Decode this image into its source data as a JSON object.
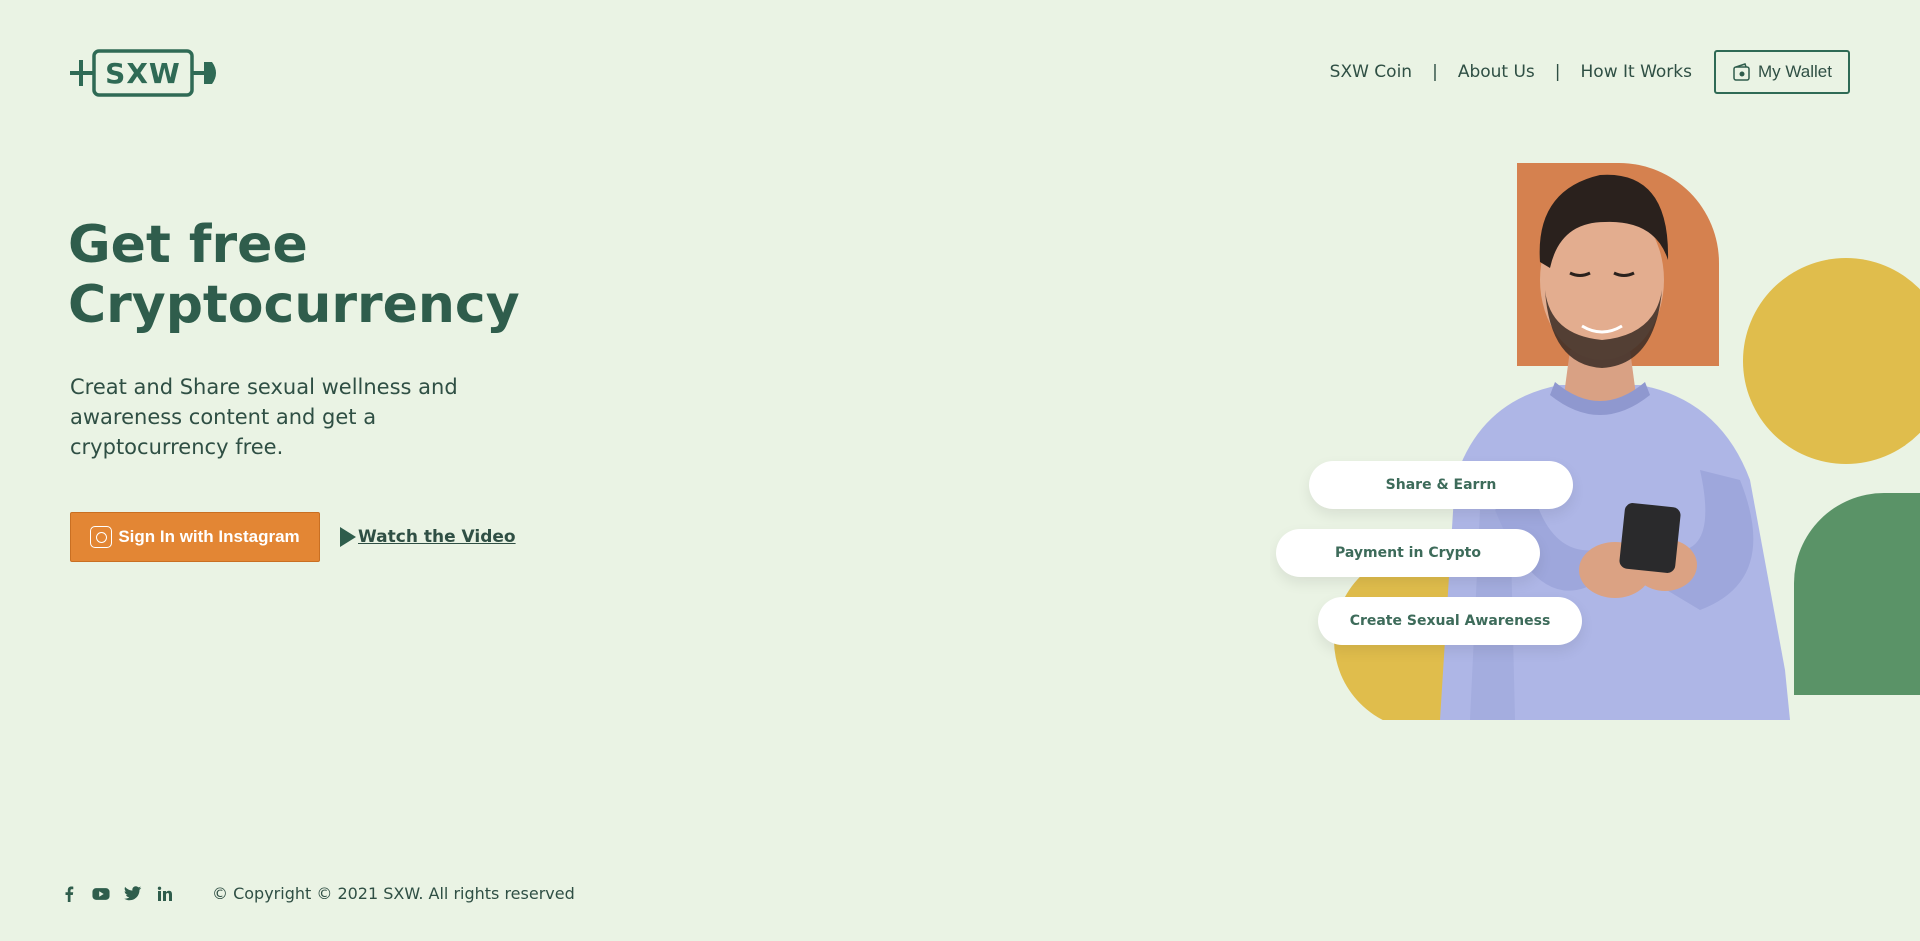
{
  "logo": {
    "text": "SXW"
  },
  "nav": {
    "items": [
      {
        "label": "SXW Coin"
      },
      {
        "label": "About Us"
      },
      {
        "label": "How It Works"
      }
    ],
    "separator": "|",
    "wallet_label": "My Wallet"
  },
  "hero": {
    "title_line1": "Get free",
    "title_line2": "Cryptocurrency",
    "subtitle": "Creat and Share sexual wellness and awareness content and get a cryptocurrency free.",
    "instagram_button": "Sign In with Instagram",
    "video_link": " Watch the Video"
  },
  "pills": [
    "Share & Earrn",
    "Payment in Crypto",
    "Create Sexual Awareness"
  ],
  "footer": {
    "social_icons": [
      "facebook-icon",
      "youtube-icon",
      "twitter-icon",
      "linkedin-icon"
    ],
    "copyright": "© Copyright © 2021 SXW. All rights reserved"
  },
  "colors": {
    "background": "#eaf3e4",
    "primary_green": "#2f5d4c",
    "accent_orange": "#e38634",
    "yellow": "#e0bd4c",
    "terracotta": "#d5814f",
    "green_shape": "#5a9367"
  }
}
